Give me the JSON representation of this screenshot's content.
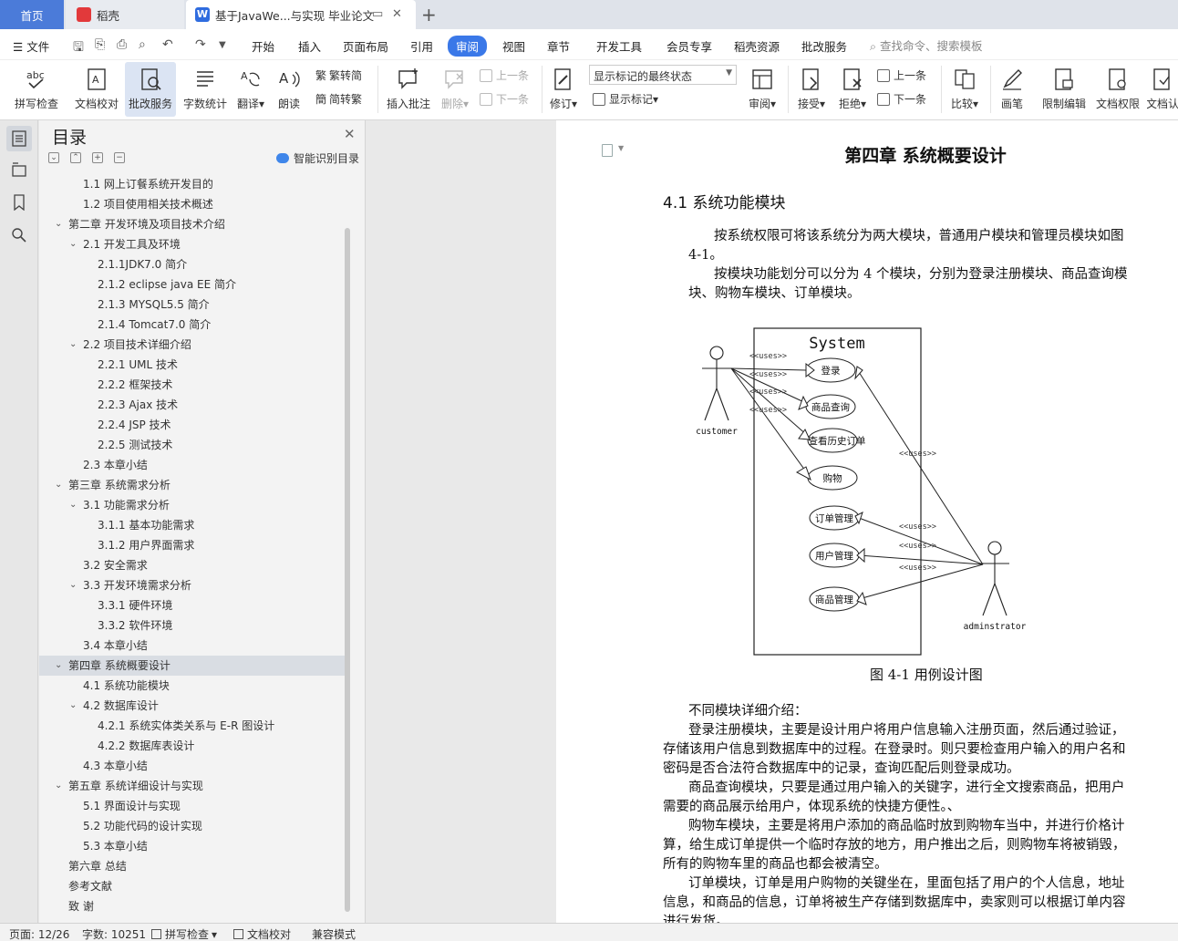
{
  "tabs": {
    "home": "首页",
    "daoke": "稻壳",
    "document": "基于JavaWe...与实现 毕业论文"
  },
  "menu": {
    "file": "文件",
    "items": [
      "开始",
      "插入",
      "页面布局",
      "引用",
      "审阅",
      "视图",
      "章节",
      "开发工具",
      "会员专享",
      "稻壳资源",
      "批改服务"
    ],
    "active": "审阅",
    "search": "查找命令、搜索模板"
  },
  "ribbon": {
    "spell_check": "拼写检查",
    "doc_proof": "文档校对",
    "review_service": "批改服务",
    "word_count": "字数统计",
    "translate": "翻译",
    "read_aloud": "朗读",
    "trad_to_simp": "繁转简",
    "simp_to_trad": "简转繁",
    "insert_comment": "插入批注",
    "delete": "删除",
    "prev_comment": "上一条",
    "next_comment": "下一条",
    "track_changes": "修订",
    "markup_state": "显示标记的最终状态",
    "show_markup": "显示标记",
    "review_pane": "审阅",
    "accept": "接受",
    "reject": "拒绝",
    "prev_change": "上一条",
    "next_change": "下一条",
    "compare": "比较",
    "ink": "画笔",
    "restrict_edit": "限制编辑",
    "doc_permission": "文档权限",
    "doc_cert": "文档认"
  },
  "toc": {
    "title": "目录",
    "smart": "智能识别目录",
    "items": [
      {
        "text": "1.1  网上订餐系统开发目的",
        "level": 2,
        "chev": false,
        "sel": false
      },
      {
        "text": "1.2  项目使用相关技术概述",
        "level": 2,
        "chev": false,
        "sel": false
      },
      {
        "text": "第二章  开发环境及项目技术介绍",
        "level": 1,
        "chev": true,
        "sel": false
      },
      {
        "text": "2.1  开发工具及环境",
        "level": 2,
        "chev": true,
        "sel": false
      },
      {
        "text": "2.1.1JDK7.0 简介",
        "level": 3,
        "chev": false,
        "sel": false
      },
      {
        "text": "2.1.2 eclipse java EE 简介",
        "level": 3,
        "chev": false,
        "sel": false
      },
      {
        "text": "2.1.3 MYSQL5.5 简介",
        "level": 3,
        "chev": false,
        "sel": false
      },
      {
        "text": "2.1.4 Tomcat7.0 简介",
        "level": 3,
        "chev": false,
        "sel": false
      },
      {
        "text": "2.2  项目技术详细介绍",
        "level": 2,
        "chev": true,
        "sel": false
      },
      {
        "text": "2.2.1 UML 技术",
        "level": 3,
        "chev": false,
        "sel": false
      },
      {
        "text": "2.2.2  框架技术",
        "level": 3,
        "chev": false,
        "sel": false
      },
      {
        "text": "2.2.3 Ajax 技术",
        "level": 3,
        "chev": false,
        "sel": false
      },
      {
        "text": "2.2.4 JSP 技术",
        "level": 3,
        "chev": false,
        "sel": false
      },
      {
        "text": "2.2.5  测试技术",
        "level": 3,
        "chev": false,
        "sel": false
      },
      {
        "text": "2.3  本章小结",
        "level": 2,
        "chev": false,
        "sel": false
      },
      {
        "text": "第三章  系统需求分析",
        "level": 1,
        "chev": true,
        "sel": false
      },
      {
        "text": "3.1  功能需求分析",
        "level": 2,
        "chev": true,
        "sel": false
      },
      {
        "text": "3.1.1  基本功能需求",
        "level": 3,
        "chev": false,
        "sel": false
      },
      {
        "text": "3.1.2  用户界面需求",
        "level": 3,
        "chev": false,
        "sel": false
      },
      {
        "text": "3.2  安全需求",
        "level": 2,
        "chev": false,
        "sel": false
      },
      {
        "text": "3.3 开发环境需求分析",
        "level": 2,
        "chev": true,
        "sel": false
      },
      {
        "text": "3.3.1  硬件环境",
        "level": 3,
        "chev": false,
        "sel": false
      },
      {
        "text": "3.3.2  软件环境",
        "level": 3,
        "chev": false,
        "sel": false
      },
      {
        "text": "3.4  本章小结",
        "level": 2,
        "chev": false,
        "sel": false
      },
      {
        "text": "第四章  系统概要设计",
        "level": 1,
        "chev": true,
        "sel": true
      },
      {
        "text": "4.1  系统功能模块",
        "level": 2,
        "chev": false,
        "sel": false
      },
      {
        "text": "4.2  数据库设计",
        "level": 2,
        "chev": true,
        "sel": false
      },
      {
        "text": "4.2.1  系统实体类关系与 E-R 图设计",
        "level": 3,
        "chev": false,
        "sel": false
      },
      {
        "text": "4.2.2  数据库表设计",
        "level": 3,
        "chev": false,
        "sel": false
      },
      {
        "text": "4.3  本章小结",
        "level": 2,
        "chev": false,
        "sel": false
      },
      {
        "text": "第五章  系统详细设计与实现",
        "level": 1,
        "chev": true,
        "sel": false
      },
      {
        "text": "5.1  界面设计与实现",
        "level": 2,
        "chev": false,
        "sel": false
      },
      {
        "text": "5.2  功能代码的设计实现",
        "level": 2,
        "chev": false,
        "sel": false
      },
      {
        "text": "5.3  本章小结",
        "level": 2,
        "chev": false,
        "sel": false
      },
      {
        "text": "第六章  总结",
        "level": 1,
        "chev": false,
        "sel": false
      },
      {
        "text": "参考文献",
        "level": 1,
        "chev": false,
        "sel": false
      },
      {
        "text": "致  谢",
        "level": 1,
        "chev": false,
        "sel": false
      }
    ]
  },
  "doc": {
    "chapter_title": "第四章  系统概要设计",
    "section_title": "4.1  系统功能模块",
    "p1a": "按系统权限可将该系统分为两大模块，普通用户模块和管理员模块如图",
    "p1b": "4-1。",
    "p2a": "按模块功能划分可以分为 4 个模块，分别为登录注册模块、商品查询模",
    "p2b": "块、购物车模块、订单模块。",
    "diagram": {
      "system_label": "System",
      "actor_customer": "customer",
      "actor_admin": "adminstrator",
      "uses": "<<uses>>",
      "use_cases": [
        "登录",
        "商品查询",
        "查看历史订单",
        "购物",
        "订单管理",
        "用户管理",
        "商品管理"
      ]
    },
    "caption": "图 4-1 用例设计图",
    "lines": [
      "不同模块详细介绍：",
      "登录注册模块，主要是设计用户将用户信息输入注册页面，然后通过验证，",
      "存储该用户信息到数据库中的过程。在登录时。则只要检查用户输入的用户名和",
      "密码是否合法符合数据库中的记录，查询匹配后则登录成功。",
      "商品查询模块，只要是通过用户输入的关键字，进行全文搜索商品，把用户",
      "需要的商品展示给用户，体现系统的快捷方便性。、",
      "购物车模块，主要是将用户添加的商品临时放到购物车当中，并进行价格计",
      "算，给生成订单提供一个临时存放的地方，用户推出之后，则购物车将被销毁，",
      "所有的购物车里的商品也都会被清空。",
      "订单模块，订单是用户购物的关键坐在，里面包括了用户的个人信息，地址",
      "信息，和商品的信息，订单将被生产存储到数据库中，卖家则可以根据订单内容",
      "进行发货。"
    ]
  },
  "status": {
    "page": "页面: 12/26",
    "words": "字数: 10251",
    "spell": "拼写检查",
    "proof": "文档校对",
    "compat": "兼容模式"
  }
}
